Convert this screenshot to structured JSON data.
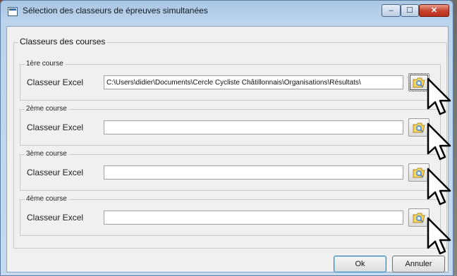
{
  "window": {
    "title": "Sélection des classeurs de épreuves simultanées",
    "minimize": "–",
    "maximize": "☐",
    "close": "✕"
  },
  "group": {
    "title": "Classeurs des courses"
  },
  "courses": [
    {
      "legend": "1ère course",
      "label": "Classeur Excel",
      "value": "C:\\Users\\didier\\Documents\\Cercle Cycliste Châtillonnais\\Organisations\\Résultats\\"
    },
    {
      "legend": "2ème course",
      "label": "Classeur Excel",
      "value": ""
    },
    {
      "legend": "3ème course",
      "label": "Classeur Excel",
      "value": ""
    },
    {
      "legend": "4ème course",
      "label": "Classeur Excel",
      "value": ""
    }
  ],
  "buttons": {
    "ok": "Ok",
    "cancel": "Annuler"
  },
  "icons": {
    "browse": "folder-search-icon",
    "cursor": "mouse-pointer-icon"
  }
}
